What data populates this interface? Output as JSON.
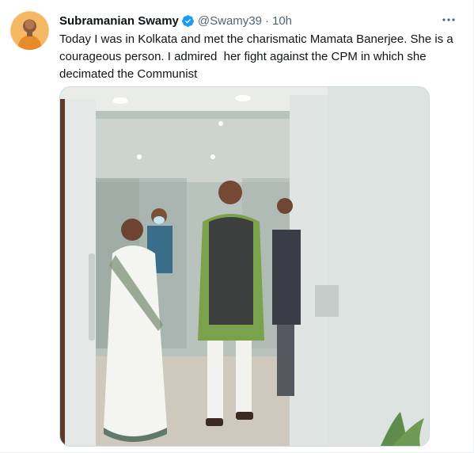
{
  "tweet": {
    "author_name": "Subramanian Swamy",
    "verified": true,
    "handle": "@Swamy39",
    "separator": "·",
    "time": "10h",
    "text": "Today I was in Kolkata and met the charismatic Mamata Banerjee. She is a\ncourageous person. I admired  her fight against the CPM in which she\ndecimated the Communist",
    "more_icon": "more-horizontal-icon",
    "verified_color": "#1d9bf0",
    "media_description": "photo"
  },
  "colors": {
    "name": "#0f1419",
    "secondary": "#536471",
    "accent": "#1d9bf0"
  }
}
